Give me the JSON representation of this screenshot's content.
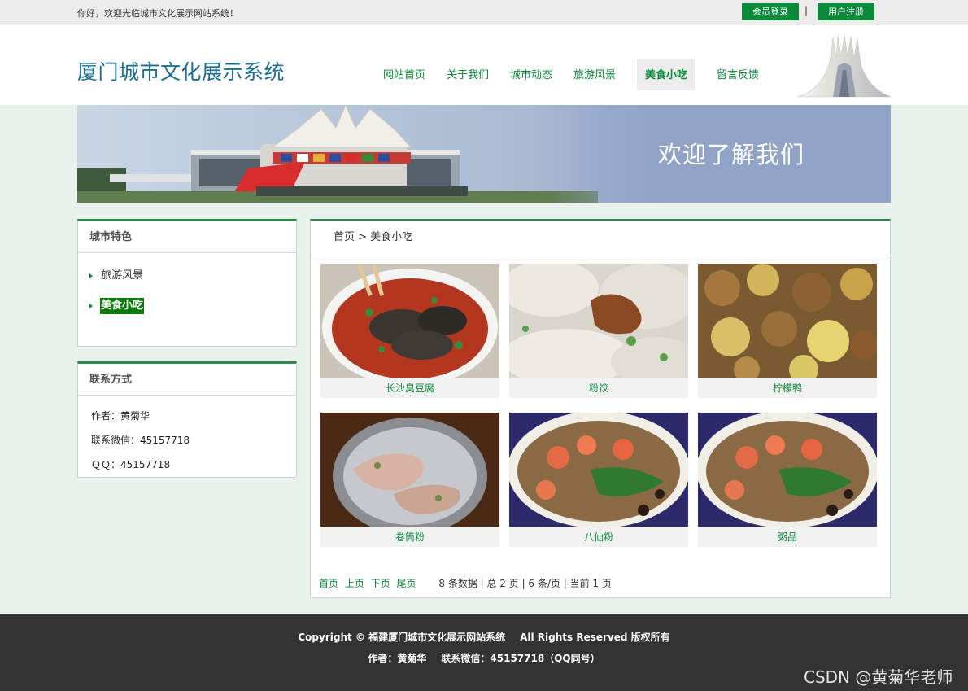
{
  "topbar": {
    "welcome": "你好，欢迎光临城市文化展示网站系统！",
    "login_label": "会员登录",
    "separator": "|",
    "register_label": "用户注册"
  },
  "header": {
    "site_title": "厦门城市文化展示系统"
  },
  "nav": {
    "items": [
      {
        "label": "网站首页"
      },
      {
        "label": "关于我们"
      },
      {
        "label": "城市动态"
      },
      {
        "label": "旅游风景"
      },
      {
        "label": "美食小吃"
      },
      {
        "label": "留言反馈"
      }
    ],
    "active": "美食小吃"
  },
  "banner": {
    "text": "欢迎了解我们"
  },
  "sidebar": {
    "categories_title": "城市特色",
    "categories": [
      {
        "label": "旅游风景"
      },
      {
        "label": "美食小吃"
      }
    ],
    "contact_title": "联系方式",
    "contact_lines": [
      "作者：黄菊华",
      "联系微信：45157718",
      "ＱＱ：45157718"
    ]
  },
  "main": {
    "breadcrumb": "首页 > 美食小吃",
    "foods": [
      {
        "name": "长沙臭豆腐"
      },
      {
        "name": "粉饺"
      },
      {
        "name": "柠檬鸭"
      },
      {
        "name": "卷筒粉"
      },
      {
        "name": "八仙粉"
      },
      {
        "name": "粥品"
      }
    ],
    "pager": {
      "first": "首页",
      "prev": "上页",
      "next": "下页",
      "last": "尾页",
      "info": "8 条数据 | 总 2 页 | 6 条/页 | 当前 1 页"
    }
  },
  "footer": {
    "copyright": "Copyright © 福建厦门城市文化展示网站系统",
    "rights": "All Rights Reserved 版权所有",
    "author": "作者：黄菊华",
    "contact": "联系微信：45157718（QQ同号）"
  },
  "watermark": "CSDN @黄菊华老师",
  "colors": {
    "accent_green": "#0b8a3a",
    "title_blue": "#1a6e92",
    "page_bg": "#e8f1ec",
    "footer_bg": "#333333"
  }
}
